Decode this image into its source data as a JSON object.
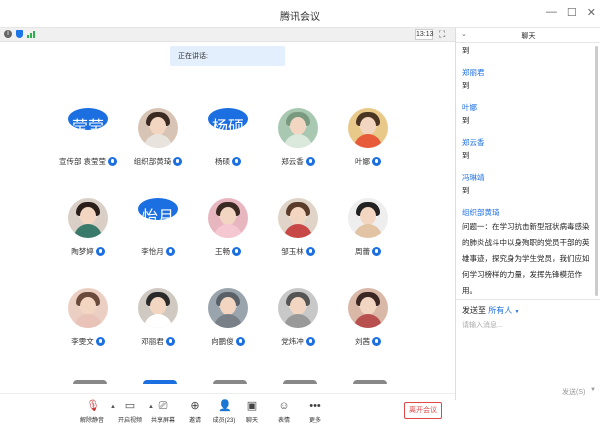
{
  "window": {
    "title": "腾讯会议"
  },
  "topbar": {
    "clock": "13:13"
  },
  "speaking_label": "正在讲话:",
  "participants": [
    {
      "name": "宣传部 袁莹莹",
      "avatar_text": "莹莹",
      "photo": false
    },
    {
      "name": "组织部黄琦",
      "avatar_text": "",
      "photo": true,
      "colors": [
        "#efe6dc",
        "#d8c4b4",
        "#3a2a22",
        "#e9e3dd"
      ]
    },
    {
      "name": "杨硕",
      "avatar_text": "杨硕",
      "photo": false
    },
    {
      "name": "郑云香",
      "avatar_text": "",
      "photo": true,
      "colors": [
        "#cfe3d6",
        "#a9c8b2",
        "#7a9a80",
        "#dbe8dc"
      ]
    },
    {
      "name": "叶娜",
      "avatar_text": "",
      "photo": true,
      "colors": [
        "#f5e5c0",
        "#e9c98a",
        "#4a3522",
        "#e75a3a"
      ]
    },
    {
      "name": "陶梦婷",
      "avatar_text": "",
      "photo": true,
      "colors": [
        "#f2e9e3",
        "#d9cfc7",
        "#2a1e1a",
        "#3a7a6a"
      ]
    },
    {
      "name": "李怡月",
      "avatar_text": "怡月",
      "photo": false
    },
    {
      "name": "王畅",
      "avatar_text": "",
      "photo": true,
      "colors": [
        "#f4dde0",
        "#e8b6bf",
        "#3a2a22",
        "#f5c7d0"
      ]
    },
    {
      "name": "邹玉林",
      "avatar_text": "",
      "photo": true,
      "colors": [
        "#f3eee8",
        "#e0d4c8",
        "#5a3a2a",
        "#c84848"
      ]
    },
    {
      "name": "周蕾",
      "avatar_text": "",
      "photo": true,
      "colors": [
        "#ffffff",
        "#eeeeee",
        "#222222",
        "#e2c4a4"
      ]
    },
    {
      "name": "李雯文",
      "avatar_text": "",
      "photo": true,
      "colors": [
        "#f7e4dc",
        "#eccfc3",
        "#6a4a3a",
        "#e9c2b8"
      ]
    },
    {
      "name": "邓丽君",
      "avatar_text": "",
      "photo": true,
      "colors": [
        "#e9e6e2",
        "#cfc9c2",
        "#2a2a2a",
        "#ffffff"
      ]
    },
    {
      "name": "向鹏俊",
      "avatar_text": "",
      "photo": true,
      "colors": [
        "#d6dbe0",
        "#9aa4ad",
        "#5a6068",
        "#7a8088"
      ]
    },
    {
      "name": "党炜冲",
      "avatar_text": "",
      "photo": true,
      "colors": [
        "#eeeeee",
        "#c8c8c8",
        "#555555",
        "#999999"
      ]
    },
    {
      "name": "刘茜",
      "avatar_text": "",
      "photo": true,
      "colors": [
        "#f0e0d8",
        "#d9b8a8",
        "#3a2622",
        "#b85050"
      ]
    }
  ],
  "toolbar": {
    "unmute": "解除静音",
    "video": "开启视频",
    "share": "共享屏幕",
    "invite": "邀请",
    "members": "成员(23)",
    "chat": "聊天",
    "emoji": "表情",
    "more": "更多",
    "leave": "离开会议"
  },
  "chat": {
    "title": "聊天",
    "messages": [
      {
        "sender": "",
        "text": "到"
      },
      {
        "sender": "郑丽君",
        "text": "到"
      },
      {
        "sender": "叶娜",
        "text": "到"
      },
      {
        "sender": "郑云香",
        "text": "到"
      },
      {
        "sender": "冯琳靖",
        "text": "到"
      },
      {
        "sender": "组织部黄琦",
        "text": ""
      }
    ],
    "question": "问题一：在学习抗击新型冠状病毒感染的肺炎战斗中以身殉职的党员干部的英雄事迹，探究身为学生党员，我们应如何学习榜样的力量，发挥先锋模范作用。",
    "send_to_label": "发送至",
    "send_to_target": "所有人",
    "input_placeholder": "请输入消息...",
    "send_button": "发送(S)"
  },
  "colors": {
    "accent": "#1c6fe0",
    "leave": "#e04848"
  }
}
